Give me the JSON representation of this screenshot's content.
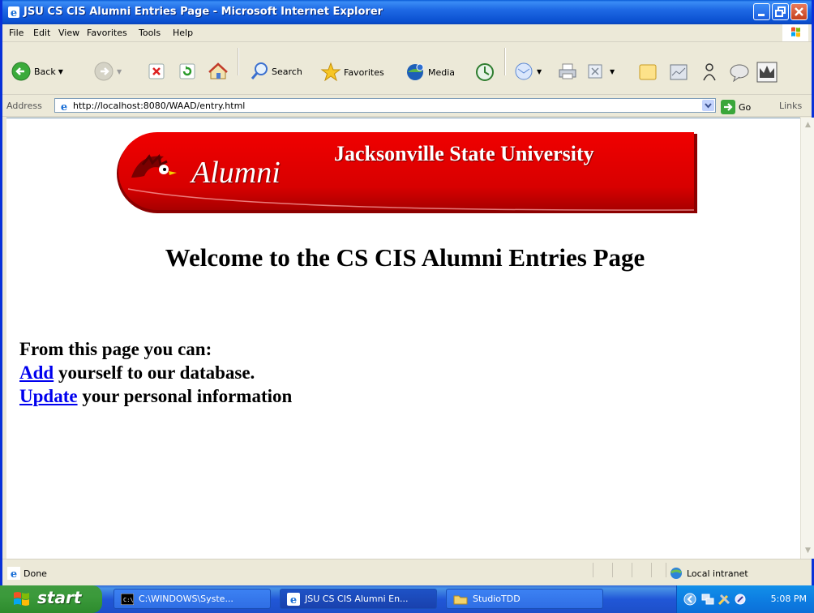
{
  "window": {
    "title": "JSU CS CIS Alumni Entries Page - Microsoft Internet Explorer"
  },
  "menu": [
    "File",
    "Edit",
    "View",
    "Favorites",
    "Tools",
    "Help"
  ],
  "toolbar": {
    "back": "Back",
    "search": "Search",
    "favorites": "Favorites",
    "media": "Media"
  },
  "address": {
    "label": "Address",
    "url": "http://localhost:8080/WAAD/entry.html",
    "go": "Go",
    "links": "Links"
  },
  "page": {
    "banner": {
      "alumni": "Alumni",
      "university": "Jacksonville State University",
      "color": "#e00000"
    },
    "heading": "Welcome to the CS CIS Alumni Entries Page",
    "intro": "From this page you can:",
    "add_link": "Add",
    "add_rest": " yourself to our database.",
    "update_link": "Update",
    "update_rest": " your personal information",
    "link_color": "#0000ee"
  },
  "status": {
    "text": "Done",
    "zone": "Local intranet"
  },
  "taskbar": {
    "start": "start",
    "tasks": [
      "C:\\WINDOWS\\Syste...",
      "JSU CS CIS Alumni En...",
      "StudioTDD"
    ],
    "clock": "5:08 PM"
  }
}
